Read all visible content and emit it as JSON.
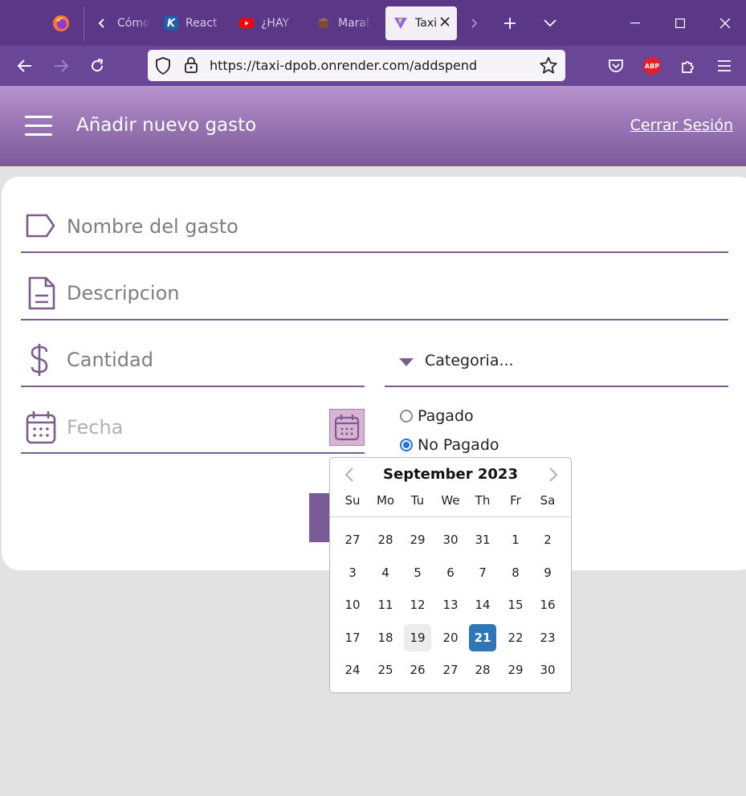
{
  "browser": {
    "tabs": [
      {
        "label": "Cómo",
        "icon": "firefox-icon"
      },
      {
        "label": "React",
        "icon": "k-logo-icon"
      },
      {
        "label": "¿HAY",
        "icon": "youtube-icon"
      },
      {
        "label": "Maral",
        "icon": "site-icon"
      },
      {
        "label": "Taxi",
        "icon": "vite-icon"
      }
    ],
    "url": "https://taxi-dpob.onrender.com/addspend",
    "adblock_label": "ABP"
  },
  "app": {
    "title": "Añadir nuevo gasto",
    "logout": "Cerrar Sesión",
    "colors": {
      "header_top": "#b995cf",
      "header_bottom": "#7c5a98",
      "accent": "#7a5d8e",
      "selected_day": "#2f76b8"
    }
  },
  "form": {
    "name_placeholder": "Nombre del gasto",
    "description_placeholder": "Descripcion",
    "amount_placeholder": "Cantidad",
    "category_placeholder": "Categoria...",
    "date_placeholder": "Fecha",
    "status_options": [
      {
        "label": "Pagado",
        "selected": false
      },
      {
        "label": "No Pagado",
        "selected": true
      }
    ]
  },
  "datepicker": {
    "month_label": "September 2023",
    "weekdays": [
      "Su",
      "Mo",
      "Tu",
      "We",
      "Th",
      "Fr",
      "Sa"
    ],
    "weeks": [
      [
        "27",
        "28",
        "29",
        "30",
        "31",
        "1",
        "2"
      ],
      [
        "3",
        "4",
        "5",
        "6",
        "7",
        "8",
        "9"
      ],
      [
        "10",
        "11",
        "12",
        "13",
        "14",
        "15",
        "16"
      ],
      [
        "17",
        "18",
        "19",
        "20",
        "21",
        "22",
        "23"
      ],
      [
        "24",
        "25",
        "26",
        "27",
        "28",
        "29",
        "30"
      ]
    ],
    "today": "19",
    "selected": "21"
  }
}
